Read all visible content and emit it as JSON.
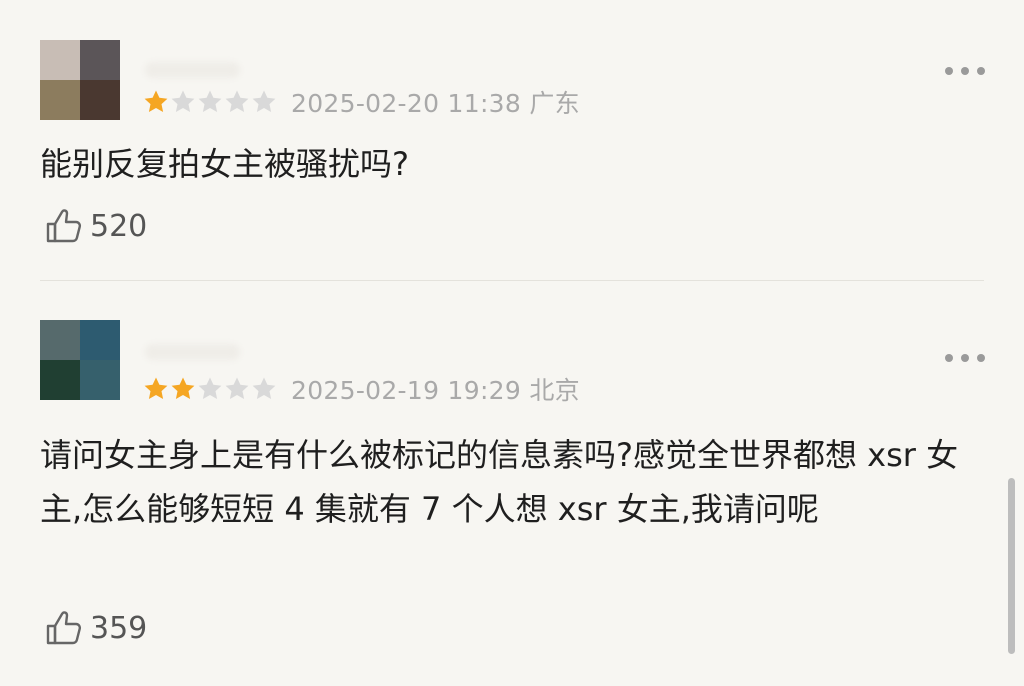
{
  "reviews": [
    {
      "rating": 1,
      "max_rating": 5,
      "timestamp": "2025-02-20 11:38 广东",
      "content": "能别反复拍女主被骚扰吗?",
      "likes": "520",
      "avatar_colors": [
        "#c8bdb5",
        "#5b5558",
        "#8c7c5e",
        "#4a3830"
      ]
    },
    {
      "rating": 2,
      "max_rating": 5,
      "timestamp": "2025-02-19 19:29 北京",
      "content": "请问女主身上是有什么被标记的信息素吗?感觉全世界都想 xsr 女主,怎么能够短短 4 集就有 7 个人想 xsr 女主,我请问呢",
      "likes": "359",
      "avatar_colors": [
        "#566a6c",
        "#2d5b70",
        "#203f32",
        "#36606c"
      ]
    }
  ],
  "colors": {
    "background": "#f7f6f2",
    "star_filled": "#f5a623",
    "star_empty": "#d9d9d9",
    "meta_text": "#a9a9a9",
    "body_text": "#1f1f1f"
  },
  "icons": {
    "more": "more-horizontal-icon",
    "like": "thumbs-up-icon",
    "star": "star-icon"
  }
}
